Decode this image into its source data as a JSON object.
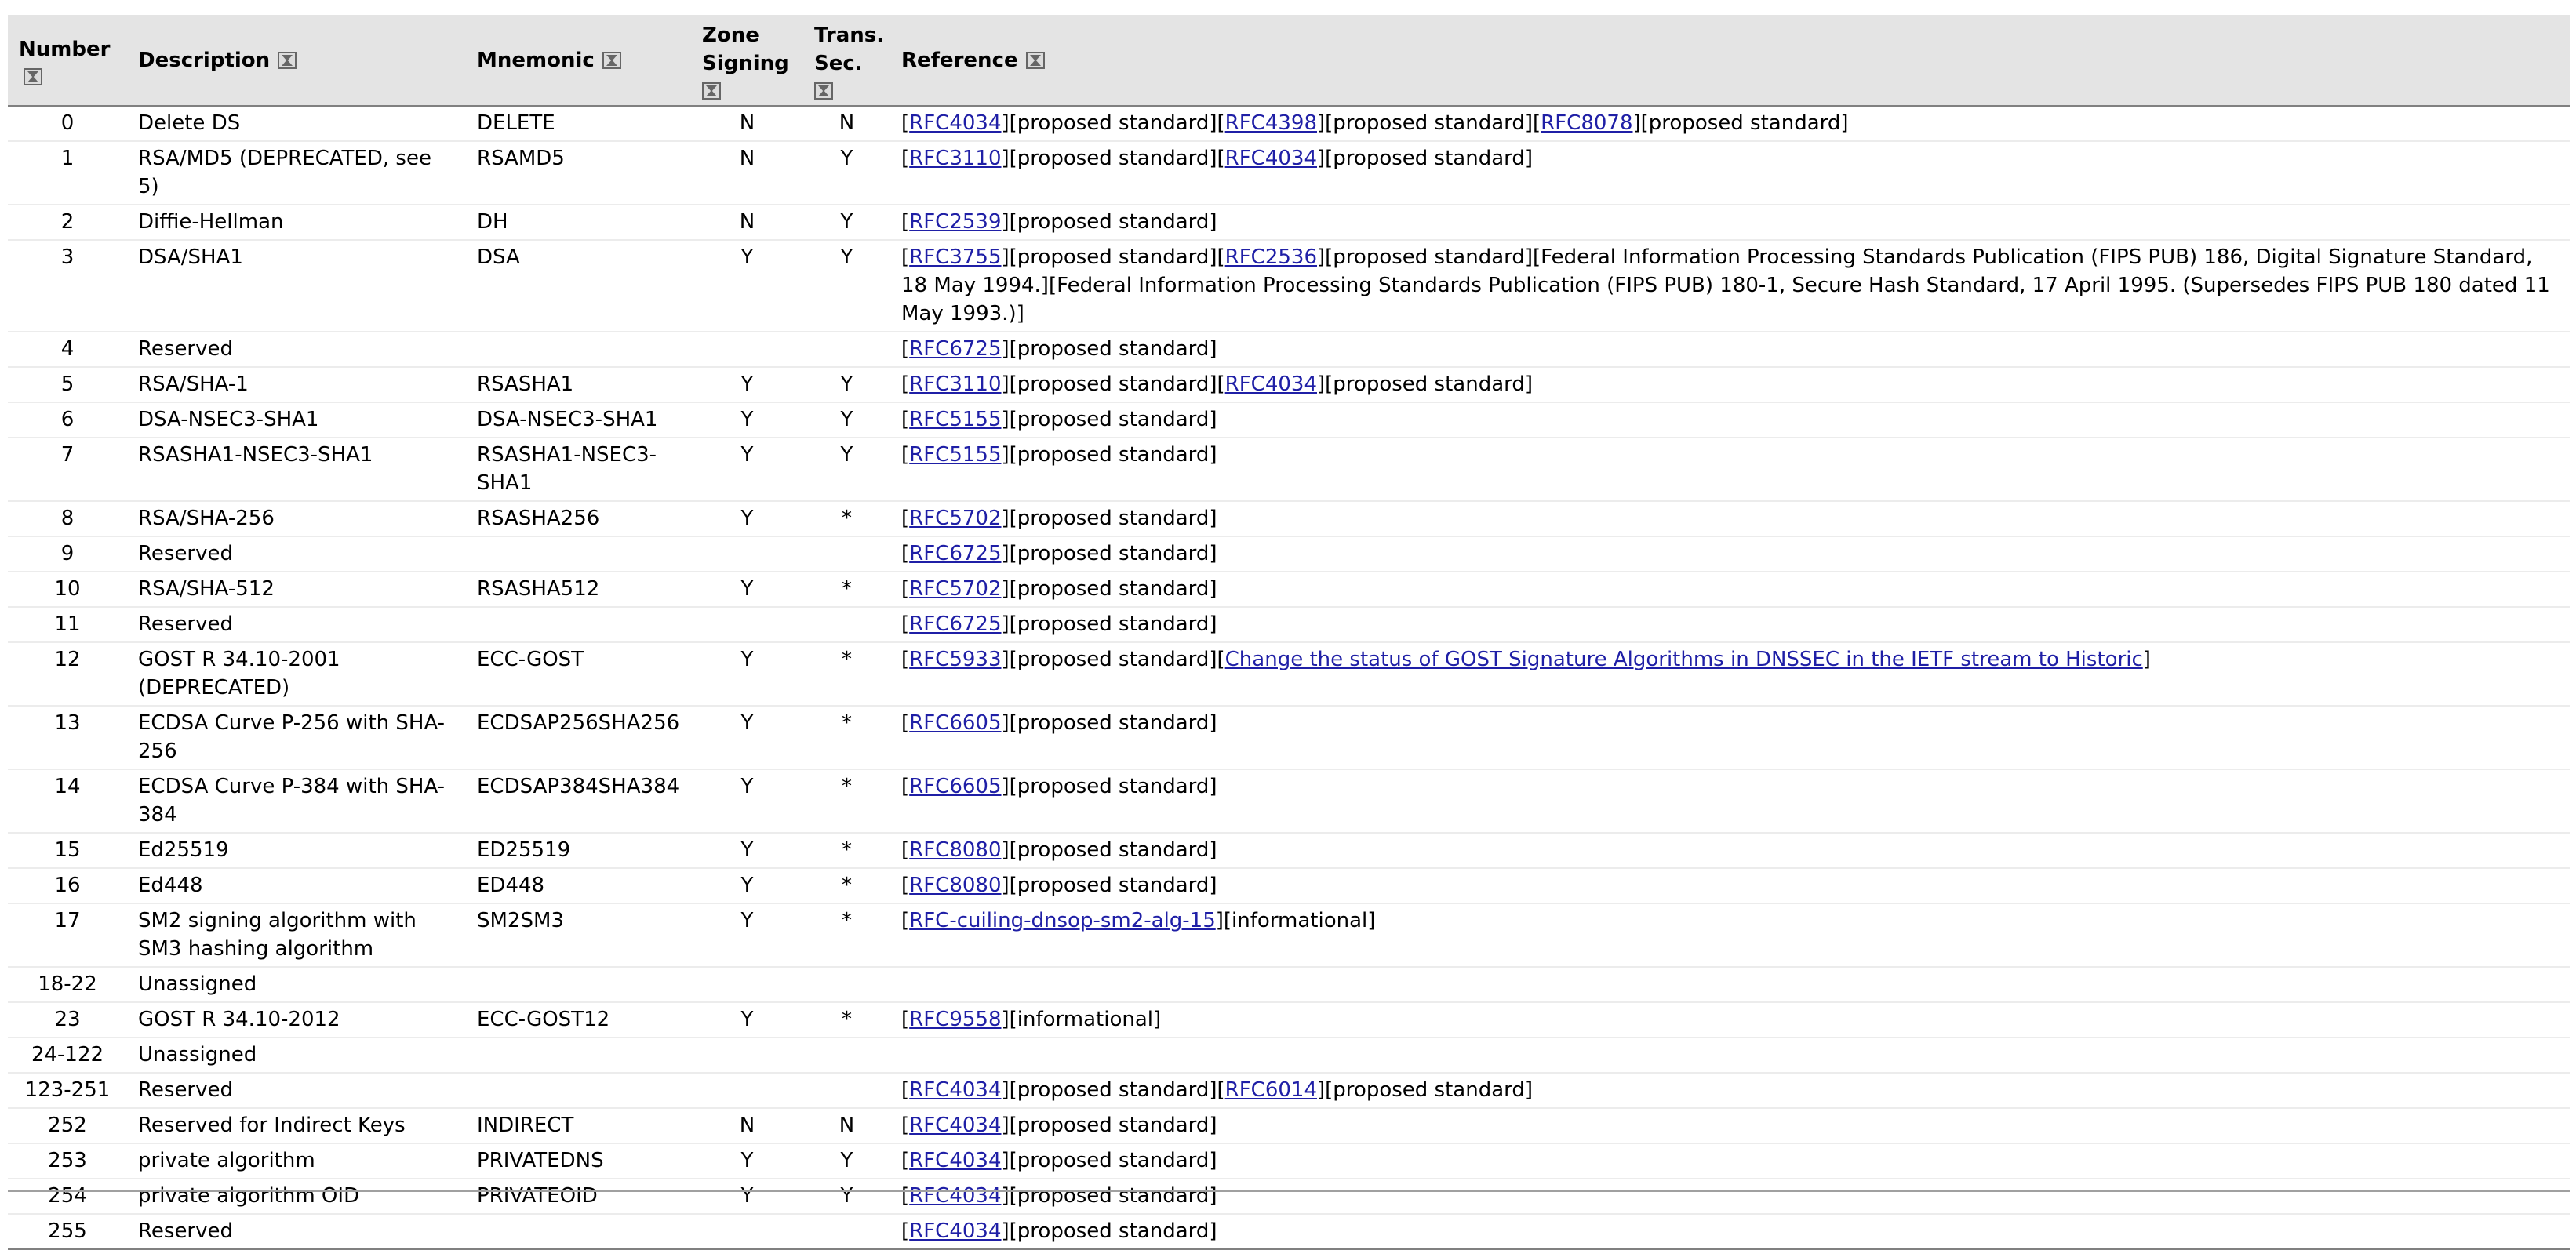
{
  "columns": {
    "number": "Number",
    "description": "Description",
    "mnemonic": "Mnemonic",
    "zone_signing": "Zone Signing",
    "trans_sec": "Trans. Sec.",
    "reference": "Reference"
  },
  "sort_icon": "hourglass-sort-icon",
  "colors": {
    "header_bg": "#e4e4e4",
    "link": "#1f1fa6",
    "row_border": "#ececec"
  },
  "rows": [
    {
      "number": "0",
      "description": "Delete DS",
      "mnemonic": "DELETE",
      "zone": "N",
      "trans": "N",
      "reference": [
        {
          "t": "["
        },
        {
          "link": "RFC4034"
        },
        {
          "t": "][proposed standard]["
        },
        {
          "link": "RFC4398"
        },
        {
          "t": "][proposed standard]["
        },
        {
          "link": "RFC8078"
        },
        {
          "t": "][proposed standard]"
        }
      ]
    },
    {
      "number": "1",
      "description": "RSA/MD5 (DEPRECATED, see 5)",
      "mnemonic": "RSAMD5",
      "zone": "N",
      "trans": "Y",
      "reference": [
        {
          "t": "["
        },
        {
          "link": "RFC3110"
        },
        {
          "t": "][proposed standard]["
        },
        {
          "link": "RFC4034"
        },
        {
          "t": "][proposed standard]"
        }
      ]
    },
    {
      "number": "2",
      "description": "Diffie-Hellman",
      "mnemonic": "DH",
      "zone": "N",
      "trans": "Y",
      "reference": [
        {
          "t": "["
        },
        {
          "link": "RFC2539"
        },
        {
          "t": "][proposed standard]"
        }
      ]
    },
    {
      "number": "3",
      "description": "DSA/SHA1",
      "mnemonic": "DSA",
      "zone": "Y",
      "trans": "Y",
      "reference": [
        {
          "t": "["
        },
        {
          "link": "RFC3755"
        },
        {
          "t": "][proposed standard]["
        },
        {
          "link": "RFC2536"
        },
        {
          "t": "][proposed standard][Federal Information Processing Standards Publication (FIPS PUB) 186, Digital Signature Standard, 18 May 1994.][Federal Information Processing Standards Publication (FIPS PUB) 180-1, Secure Hash Standard, 17 April 1995. (Supersedes FIPS PUB 180 dated 11 May 1993.)]"
        }
      ]
    },
    {
      "number": "4",
      "description": "Reserved",
      "mnemonic": "",
      "zone": "",
      "trans": "",
      "reference": [
        {
          "t": "["
        },
        {
          "link": "RFC6725"
        },
        {
          "t": "][proposed standard]"
        }
      ]
    },
    {
      "number": "5",
      "description": "RSA/SHA-1",
      "mnemonic": "RSASHA1",
      "zone": "Y",
      "trans": "Y",
      "reference": [
        {
          "t": "["
        },
        {
          "link": "RFC3110"
        },
        {
          "t": "][proposed standard]["
        },
        {
          "link": "RFC4034"
        },
        {
          "t": "][proposed standard]"
        }
      ]
    },
    {
      "number": "6",
      "description": "DSA-NSEC3-SHA1",
      "mnemonic": "DSA-NSEC3-SHA1",
      "zone": "Y",
      "trans": "Y",
      "reference": [
        {
          "t": "["
        },
        {
          "link": "RFC5155"
        },
        {
          "t": "][proposed standard]"
        }
      ]
    },
    {
      "number": "7",
      "description": "RSASHA1-NSEC3-SHA1",
      "mnemonic": "RSASHA1-NSEC3-SHA1",
      "zone": "Y",
      "trans": "Y",
      "reference": [
        {
          "t": "["
        },
        {
          "link": "RFC5155"
        },
        {
          "t": "][proposed standard]"
        }
      ]
    },
    {
      "number": "8",
      "description": "RSA/SHA-256",
      "mnemonic": "RSASHA256",
      "zone": "Y",
      "trans": "*",
      "reference": [
        {
          "t": "["
        },
        {
          "link": "RFC5702"
        },
        {
          "t": "][proposed standard]"
        }
      ]
    },
    {
      "number": "9",
      "description": "Reserved",
      "mnemonic": "",
      "zone": "",
      "trans": "",
      "reference": [
        {
          "t": "["
        },
        {
          "link": "RFC6725"
        },
        {
          "t": "][proposed standard]"
        }
      ]
    },
    {
      "number": "10",
      "description": "RSA/SHA-512",
      "mnemonic": "RSASHA512",
      "zone": "Y",
      "trans": "*",
      "reference": [
        {
          "t": "["
        },
        {
          "link": "RFC5702"
        },
        {
          "t": "][proposed standard]"
        }
      ]
    },
    {
      "number": "11",
      "description": "Reserved",
      "mnemonic": "",
      "zone": "",
      "trans": "",
      "reference": [
        {
          "t": "["
        },
        {
          "link": "RFC6725"
        },
        {
          "t": "][proposed standard]"
        }
      ]
    },
    {
      "number": "12",
      "description": "GOST R 34.10-2001 (DEPRECATED)",
      "mnemonic": "ECC-GOST",
      "zone": "Y",
      "trans": "*",
      "reference": [
        {
          "t": "["
        },
        {
          "link": "RFC5933"
        },
        {
          "t": "][proposed standard]["
        },
        {
          "link": "Change the status of GOST Signature Algorithms in DNSSEC in the IETF stream to Historic"
        },
        {
          "t": "]"
        }
      ]
    },
    {
      "number": "13",
      "description": "ECDSA Curve P-256 with SHA-256",
      "mnemonic": "ECDSAP256SHA256",
      "zone": "Y",
      "trans": "*",
      "reference": [
        {
          "t": "["
        },
        {
          "link": "RFC6605"
        },
        {
          "t": "][proposed standard]"
        }
      ]
    },
    {
      "number": "14",
      "description": "ECDSA Curve P-384 with SHA-384",
      "mnemonic": "ECDSAP384SHA384",
      "zone": "Y",
      "trans": "*",
      "reference": [
        {
          "t": "["
        },
        {
          "link": "RFC6605"
        },
        {
          "t": "][proposed standard]"
        }
      ]
    },
    {
      "number": "15",
      "description": "Ed25519",
      "mnemonic": "ED25519",
      "zone": "Y",
      "trans": "*",
      "reference": [
        {
          "t": "["
        },
        {
          "link": "RFC8080"
        },
        {
          "t": "][proposed standard]"
        }
      ]
    },
    {
      "number": "16",
      "description": "Ed448",
      "mnemonic": "ED448",
      "zone": "Y",
      "trans": "*",
      "reference": [
        {
          "t": "["
        },
        {
          "link": "RFC8080"
        },
        {
          "t": "][proposed standard]"
        }
      ]
    },
    {
      "number": "17",
      "description": "SM2 signing algorithm with SM3 hashing algorithm",
      "mnemonic": "SM2SM3",
      "zone": "Y",
      "trans": "*",
      "reference": [
        {
          "t": "["
        },
        {
          "link": "RFC-cuiling-dnsop-sm2-alg-15"
        },
        {
          "t": "][informational]"
        }
      ]
    },
    {
      "number": "18-22",
      "description": "Unassigned",
      "mnemonic": "",
      "zone": "",
      "trans": "",
      "reference": []
    },
    {
      "number": "23",
      "description": "GOST R 34.10-2012",
      "mnemonic": "ECC-GOST12",
      "zone": "Y",
      "trans": "*",
      "reference": [
        {
          "t": "["
        },
        {
          "link": "RFC9558"
        },
        {
          "t": "][informational]"
        }
      ]
    },
    {
      "number": "24-122",
      "description": "Unassigned",
      "mnemonic": "",
      "zone": "",
      "trans": "",
      "reference": []
    },
    {
      "number": "123-251",
      "description": "Reserved",
      "mnemonic": "",
      "zone": "",
      "trans": "",
      "reference": [
        {
          "t": "["
        },
        {
          "link": "RFC4034"
        },
        {
          "t": "][proposed standard]["
        },
        {
          "link": "RFC6014"
        },
        {
          "t": "][proposed standard]"
        }
      ]
    },
    {
      "number": "252",
      "description": "Reserved for Indirect Keys",
      "mnemonic": "INDIRECT",
      "zone": "N",
      "trans": "N",
      "reference": [
        {
          "t": "["
        },
        {
          "link": "RFC4034"
        },
        {
          "t": "][proposed standard]"
        }
      ]
    },
    {
      "number": "253",
      "description": "private algorithm",
      "mnemonic": "PRIVATEDNS",
      "zone": "Y",
      "trans": "Y",
      "reference": [
        {
          "t": "["
        },
        {
          "link": "RFC4034"
        },
        {
          "t": "][proposed standard]"
        }
      ]
    },
    {
      "number": "254",
      "description": "private algorithm OID",
      "mnemonic": "PRIVATEOID",
      "zone": "Y",
      "trans": "Y",
      "reference": [
        {
          "t": "["
        },
        {
          "link": "RFC4034"
        },
        {
          "t": "][proposed standard]"
        }
      ]
    },
    {
      "number": "255",
      "description": "Reserved",
      "mnemonic": "",
      "zone": "",
      "trans": "",
      "reference": [
        {
          "t": "["
        },
        {
          "link": "RFC4034"
        },
        {
          "t": "][proposed standard]"
        }
      ]
    }
  ]
}
